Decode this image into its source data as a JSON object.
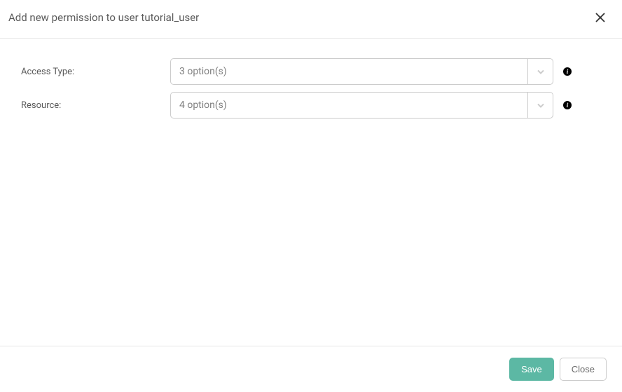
{
  "header": {
    "title": "Add new permission to user tutorial_user"
  },
  "form": {
    "access_type": {
      "label": "Access Type:",
      "placeholder": "3 option(s)"
    },
    "resource": {
      "label": "Resource:",
      "placeholder": "4 option(s)"
    }
  },
  "footer": {
    "save_label": "Save",
    "close_label": "Close"
  }
}
